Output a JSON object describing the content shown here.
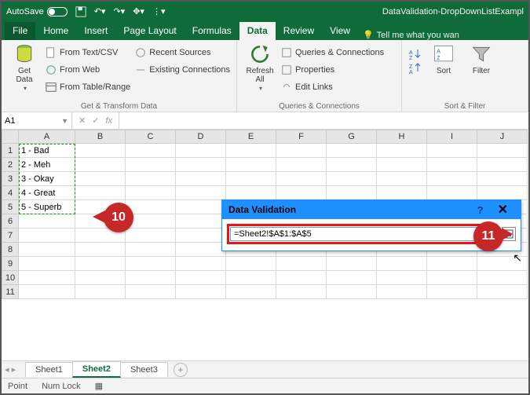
{
  "titlebar": {
    "autosave": "AutoSave",
    "doc": "DataValidation-DropDownListExampl"
  },
  "tabs": {
    "file": "File",
    "home": "Home",
    "insert": "Insert",
    "pagelayout": "Page Layout",
    "formulas": "Formulas",
    "data": "Data",
    "review": "Review",
    "view": "View",
    "tellme": "Tell me what you wan"
  },
  "ribbon": {
    "getdata": "Get\nData",
    "fromtext": "From Text/CSV",
    "fromweb": "From Web",
    "fromtable": "From Table/Range",
    "recent": "Recent Sources",
    "existing": "Existing Connections",
    "group1": "Get & Transform Data",
    "refresh": "Refresh\nAll",
    "queries": "Queries & Connections",
    "properties": "Properties",
    "editlinks": "Edit Links",
    "group2": "Queries & Connections",
    "sort": "Sort",
    "filter": "Filter",
    "group3": "Sort & Filter"
  },
  "namebox": "A1",
  "columns": [
    "A",
    "B",
    "C",
    "D",
    "E",
    "F",
    "G",
    "H",
    "I",
    "J"
  ],
  "rows": [
    "1",
    "2",
    "3",
    "4",
    "5",
    "6",
    "7",
    "8",
    "9",
    "10",
    "11"
  ],
  "cellsA": [
    "1 - Bad",
    "2 - Meh",
    "3 - Okay",
    "4 - Great",
    "5 - Superb"
  ],
  "dv": {
    "title": "Data Validation",
    "formula": "=Sheet2!$A$1:$A$5"
  },
  "sheets": {
    "s1": "Sheet1",
    "s2": "Sheet2",
    "s3": "Sheet3"
  },
  "status": {
    "mode": "Point",
    "numlock": "Num Lock"
  },
  "callouts": {
    "c10": "10",
    "c11": "11"
  }
}
